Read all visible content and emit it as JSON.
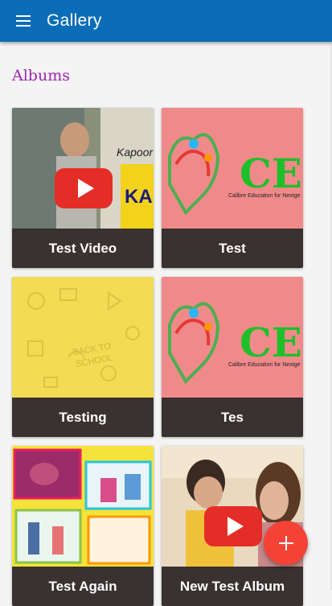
{
  "appbar": {
    "title": "Gallery",
    "menu_icon": "hamburger-menu-icon",
    "color": "#0b6db7"
  },
  "section": {
    "title": "Albums",
    "color": "#9c27b0"
  },
  "albums": [
    {
      "label": "Test Video",
      "type": "video"
    },
    {
      "label": "Test",
      "type": "image",
      "logo_text": "CEN",
      "logo_subtext": "Calibre Education for Nextge"
    },
    {
      "label": "Testing",
      "type": "image"
    },
    {
      "label": "Tes",
      "type": "image",
      "logo_text": "CEN",
      "logo_subtext": "Calibre Education for Nextge"
    },
    {
      "label": "Test Again",
      "type": "image"
    },
    {
      "label": "New Test Album",
      "type": "video"
    }
  ],
  "fab": {
    "icon": "plus-icon",
    "color": "#f44336"
  }
}
